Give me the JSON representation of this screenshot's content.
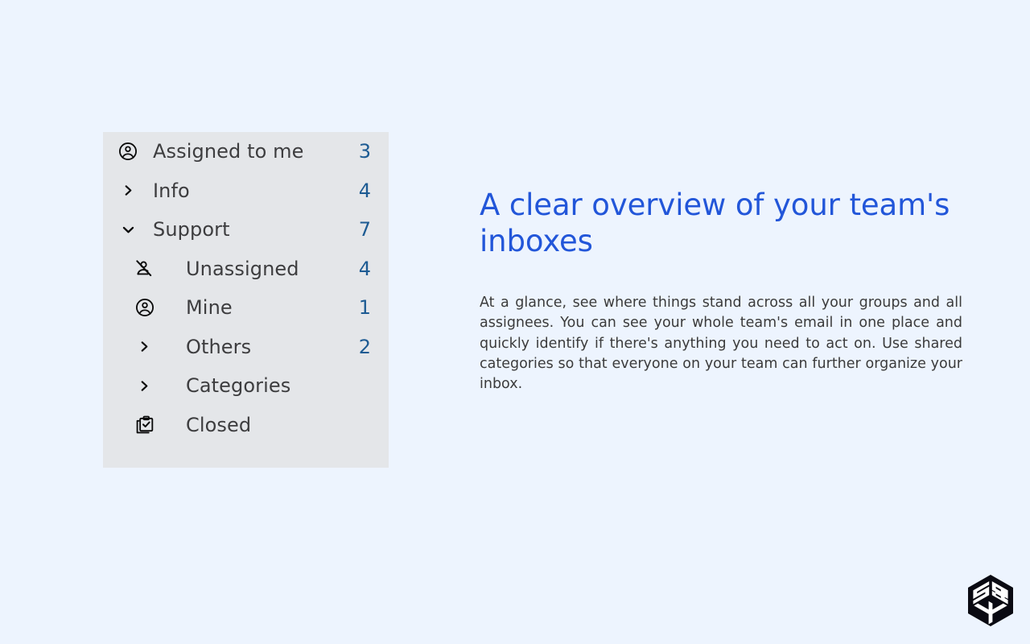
{
  "theme": {
    "page_background": "#edf4fe",
    "panel_background": "#e4e6e9",
    "label_color": "#3d3d3f",
    "badge_color": "#1d5b93",
    "headline_color": "#2256d9",
    "body_color": "#3b3b3b"
  },
  "sidebar": {
    "items": [
      {
        "label": "Assigned to me",
        "badge": "3",
        "icon": "account-circle-icon",
        "level": 0,
        "expandable": false
      },
      {
        "label": "Info",
        "badge": "4",
        "icon": "chevron-right-icon",
        "level": 0,
        "expandable": true,
        "expanded": false
      },
      {
        "label": "Support",
        "badge": "7",
        "icon": "chevron-down-icon",
        "level": 0,
        "expandable": true,
        "expanded": true
      },
      {
        "label": "Unassigned",
        "badge": "4",
        "icon": "person-off-icon",
        "level": 1,
        "expandable": false
      },
      {
        "label": "Mine",
        "badge": "1",
        "icon": "account-circle-icon",
        "level": 1,
        "expandable": false
      },
      {
        "label": "Others",
        "badge": "2",
        "icon": "chevron-right-icon",
        "level": 1,
        "expandable": true,
        "expanded": false
      },
      {
        "label": "Categories",
        "badge": "",
        "icon": "chevron-right-icon",
        "level": 1,
        "expandable": true,
        "expanded": false
      },
      {
        "label": "Closed",
        "badge": "",
        "icon": "clipboard-check-icon",
        "level": 1,
        "expandable": false
      }
    ]
  },
  "content": {
    "headline": "A clear overview of your team's inboxes",
    "body": "At a glance, see where things stand across all your groups and all assignees. You can see your whole team's email in one place and quickly identify if there's anything you need to act on. Use shared categories so that everyone on your team can further organize your inbox."
  },
  "logo": {
    "name": "hexagon-cube-logo",
    "color": "#0a0a12"
  }
}
